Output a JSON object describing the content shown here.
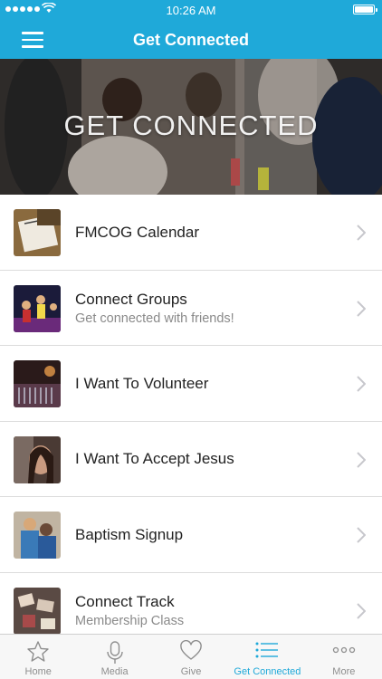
{
  "status_bar": {
    "time": "10:26 AM"
  },
  "nav": {
    "title": "Get Connected"
  },
  "hero": {
    "title": "GET CONNECTED"
  },
  "list": [
    {
      "title": "FMCOG Calendar",
      "subtitle": "",
      "icon": "calendar-thumbnail"
    },
    {
      "title": "Connect Groups",
      "subtitle": "Get connected with friends!",
      "icon": "groups-thumbnail"
    },
    {
      "title": "I Want To Volunteer",
      "subtitle": "",
      "icon": "volunteer-thumbnail"
    },
    {
      "title": "I Want To Accept Jesus",
      "subtitle": "",
      "icon": "accept-jesus-thumbnail"
    },
    {
      "title": "Baptism Signup",
      "subtitle": "",
      "icon": "baptism-thumbnail"
    },
    {
      "title": "Connect Track",
      "subtitle": "Membership Class",
      "icon": "track-thumbnail"
    }
  ],
  "tabs": [
    {
      "label": "Home",
      "icon": "star-icon"
    },
    {
      "label": "Media",
      "icon": "microphone-icon"
    },
    {
      "label": "Give",
      "icon": "heart-icon"
    },
    {
      "label": "Get Connected",
      "icon": "list-icon",
      "active": true
    },
    {
      "label": "More",
      "icon": "more-icon"
    }
  ],
  "colors": {
    "accent": "#1fa9d9",
    "inactive": "#8e8e8e"
  }
}
